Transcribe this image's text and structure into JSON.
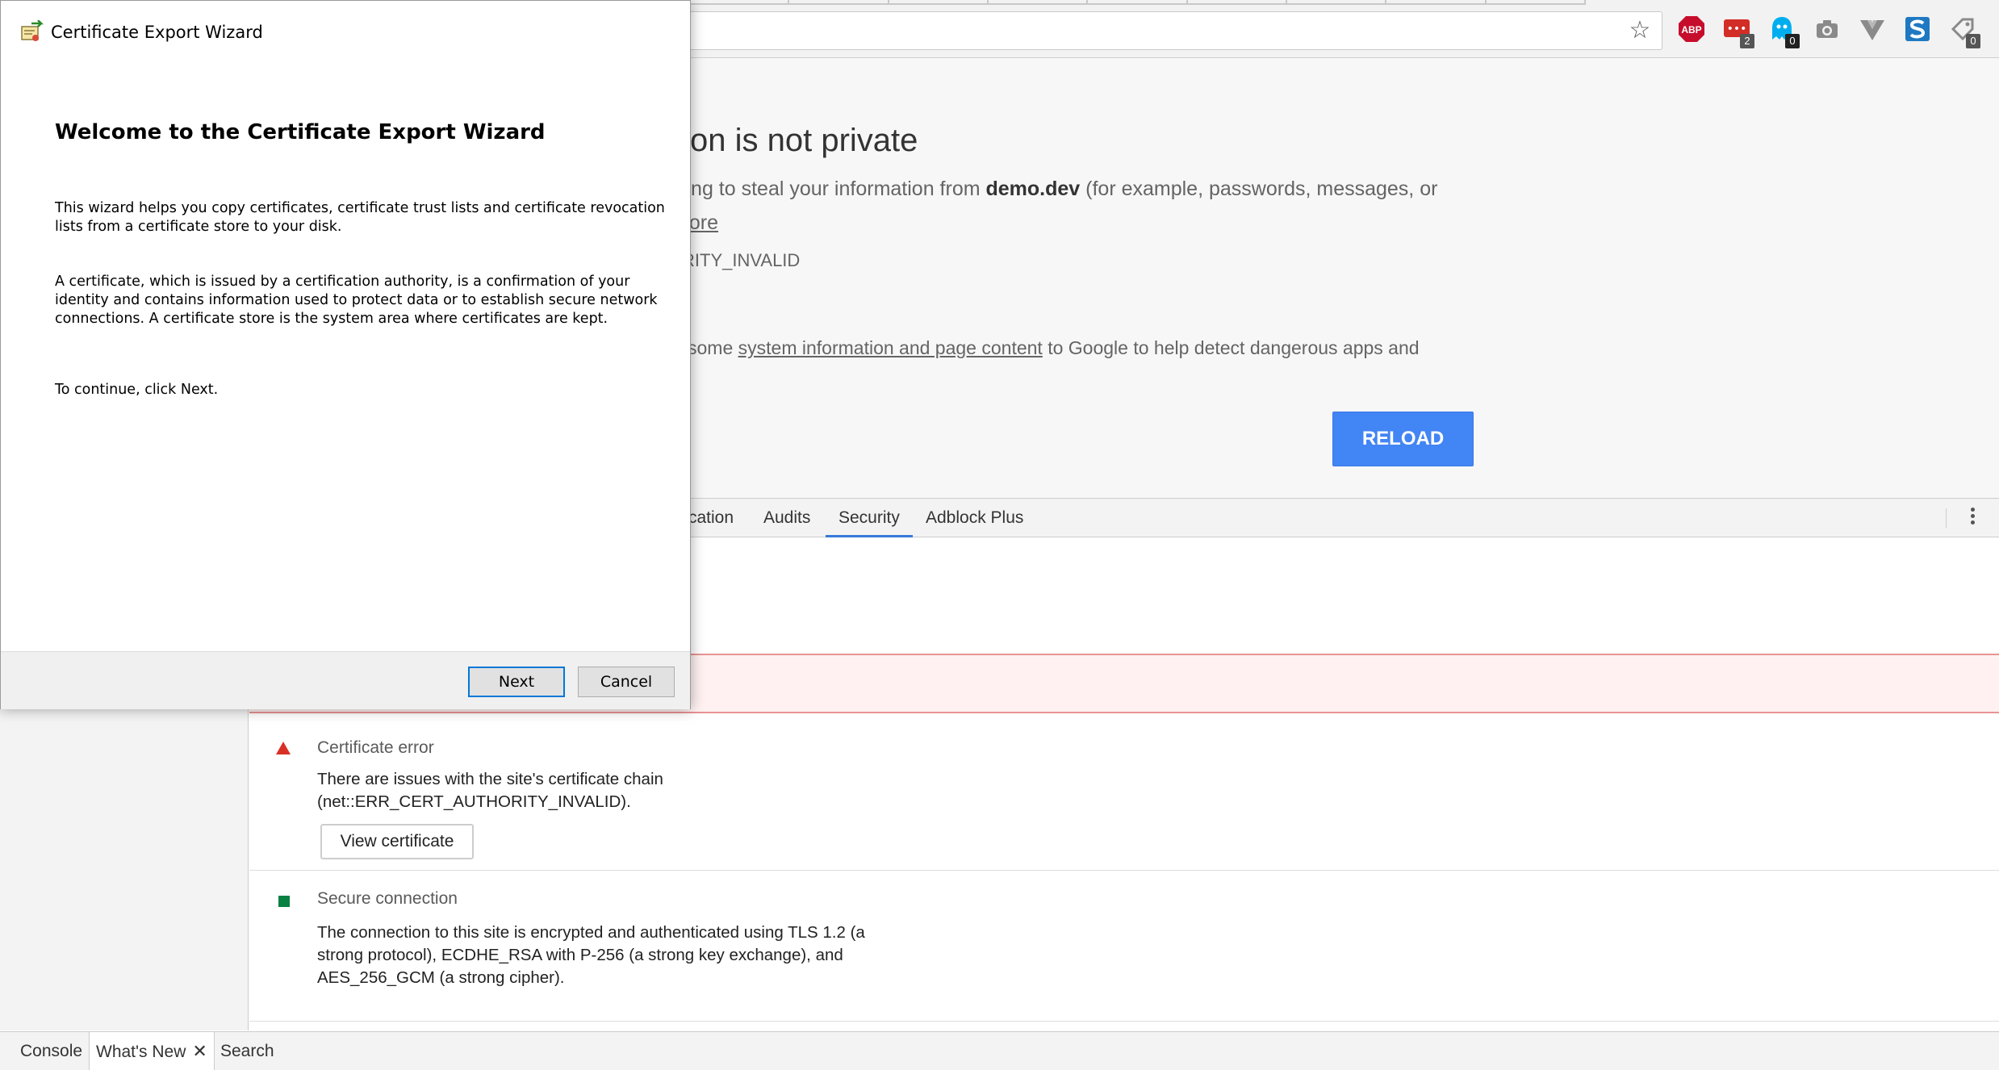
{
  "browser": {
    "extensions": [
      {
        "name": "adblock-plus",
        "label": "ABP",
        "badge": ""
      },
      {
        "name": "lastpass",
        "label": "•••",
        "badge": "2"
      },
      {
        "name": "ghostery",
        "label": "",
        "badge": "0"
      },
      {
        "name": "screenshot",
        "label": "",
        "badge": ""
      },
      {
        "name": "vue-devtools",
        "label": "",
        "badge": ""
      },
      {
        "name": "stylus",
        "label": "",
        "badge": ""
      },
      {
        "name": "tag-extension",
        "label": "",
        "badge": "0"
      }
    ]
  },
  "interstitial": {
    "title": "on is not private",
    "desc_prefix": "ying to steal your information from ",
    "domain": "demo.dev",
    "desc_suffix": " (for example, passwords, messages, or",
    "learn_more": "nore",
    "error_code": "RITY_INVALID",
    "sbe_prefix": " some ",
    "sbe_link": "system information and page content",
    "sbe_suffix": " to Google to help detect dangerous apps and",
    "reload_label": "RELOAD"
  },
  "devtools": {
    "tabs": [
      "cation",
      "Audits",
      "Security",
      "Adblock Plus"
    ],
    "security": {
      "cert_title": "Certificate error",
      "cert_desc": "There are issues with the site's certificate chain (net::ERR_CERT_AUTHORITY_INVALID).",
      "view_cert_label": "View certificate",
      "conn_title": "Secure connection",
      "conn_desc": "The connection to this site is encrypted and authenticated using TLS 1.2 (a strong protocol), ECDHE_RSA with P-256 (a strong key exchange), and AES_256_GCM (a strong cipher)."
    },
    "drawer": {
      "tabs": [
        "Console",
        "What's New",
        "Search"
      ],
      "close_glyph": "✕"
    }
  },
  "wizard": {
    "title": "Certificate Export Wizard",
    "heading": "Welcome to the Certificate Export Wizard",
    "para1": "This wizard helps you copy certificates, certificate trust lists and certificate revocation lists from a certificate store to your disk.",
    "para2": "A certificate, which is issued by a certification authority, is a confirmation of your identity and contains information used to protect data or to establish secure network connections. A certificate store is the system area where certificates are kept.",
    "para3": "To continue, click Next.",
    "next_label": "Next",
    "cancel_label": "Cancel"
  },
  "colors": {
    "accent": "#4285f4",
    "error": "#d93025",
    "secure": "#0b8043",
    "tab_underline": "#3879d9"
  }
}
